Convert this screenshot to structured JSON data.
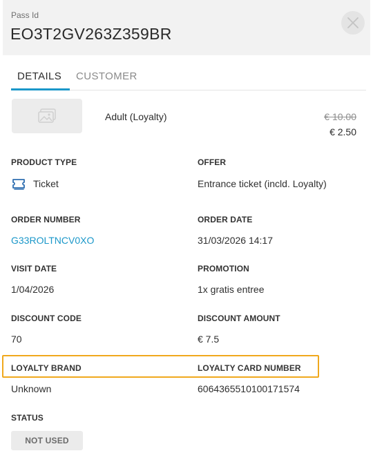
{
  "header": {
    "pass_label": "Pass Id",
    "pass_id": "EO3T2GV263Z359BR"
  },
  "tabs": [
    {
      "label": "DETAILS",
      "active": true
    },
    {
      "label": "CUSTOMER",
      "active": false
    }
  ],
  "product": {
    "name": "Adult (Loyalty)",
    "price_original": "€ 10.00",
    "price_current": "€ 2.50",
    "thumbnail_icon": "image-placeholder-icon"
  },
  "fields": {
    "product_type": {
      "label": "PRODUCT TYPE",
      "value": "Ticket",
      "icon": "ticket-icon"
    },
    "offer": {
      "label": "OFFER",
      "value": "Entrance ticket (incld. Loyalty)"
    },
    "order_number": {
      "label": "ORDER NUMBER",
      "value": "G33ROLTNCV0XO"
    },
    "order_date": {
      "label": "ORDER DATE",
      "value": "31/03/2026 14:17"
    },
    "visit_date": {
      "label": "VISIT DATE",
      "value": "1/04/2026"
    },
    "promotion": {
      "label": "PROMOTION",
      "value": "1x gratis entree"
    },
    "discount_code": {
      "label": "DISCOUNT CODE",
      "value": "70"
    },
    "discount_amount": {
      "label": "DISCOUNT AMOUNT",
      "value": "€ 7.5"
    },
    "loyalty_brand": {
      "label": "LOYALTY BRAND",
      "value": "Unknown"
    },
    "loyalty_card_number": {
      "label": "LOYALTY CARD NUMBER",
      "value": "6064365510100171574"
    },
    "status": {
      "label": "STATUS",
      "value": "NOT USED"
    }
  },
  "colors": {
    "accent": "#1a97c9",
    "highlight": "#f0a81c",
    "header_bg": "#f2f2f2"
  }
}
